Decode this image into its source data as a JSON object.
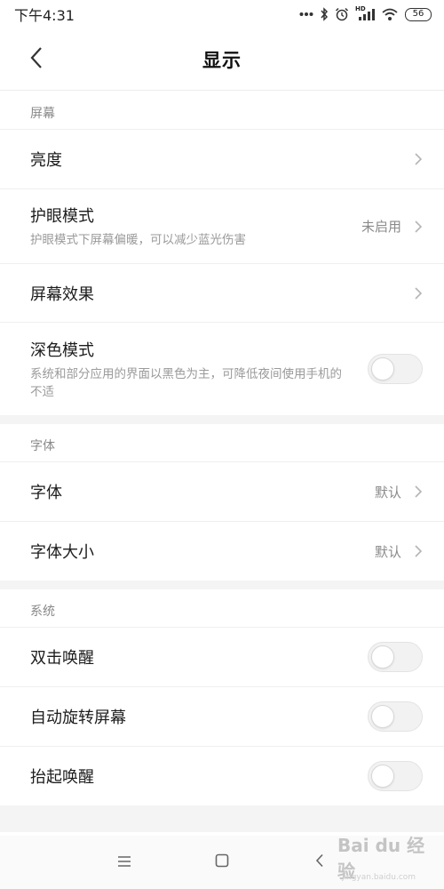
{
  "status_bar": {
    "time": "下午4:31",
    "signal_badge": "HD",
    "battery": "56",
    "icons": [
      "more-dots-icon",
      "bluetooth-icon",
      "alarm-icon",
      "signal-icon",
      "wifi-icon",
      "battery-icon"
    ]
  },
  "header": {
    "title": "显示",
    "back_icon": "chevron-left-icon"
  },
  "sections": {
    "screen": {
      "label": "屏幕",
      "brightness": {
        "title": "亮度"
      },
      "eye_care": {
        "title": "护眼模式",
        "subtitle": "护眼模式下屏幕偏暖，可以减少蓝光伤害",
        "value": "未启用"
      },
      "screen_effect": {
        "title": "屏幕效果"
      },
      "dark_mode": {
        "title": "深色模式",
        "subtitle": "系统和部分应用的界面以黑色为主，可降低夜间使用手机的不适",
        "enabled": false
      }
    },
    "font": {
      "label": "字体",
      "font": {
        "title": "字体",
        "value": "默认"
      },
      "font_size": {
        "title": "字体大小",
        "value": "默认"
      }
    },
    "system": {
      "label": "系统",
      "double_tap_wake": {
        "title": "双击唤醒",
        "enabled": false
      },
      "auto_rotate": {
        "title": "自动旋转屏幕",
        "enabled": false
      },
      "raise_to_wake": {
        "title": "抬起唤醒",
        "enabled": false
      }
    }
  },
  "nav_bar": {
    "icons": [
      "menu-icon",
      "home-icon",
      "back-icon"
    ]
  },
  "watermark": {
    "text": "Bai du 经验",
    "sub": "jingyan.baidu.com"
  },
  "colors": {
    "background": "#ffffff",
    "divider": "#efefef",
    "section_gap": "#f4f4f4",
    "secondary_text": "#9a9a9a",
    "toggle_off": "#f2f2f2"
  }
}
